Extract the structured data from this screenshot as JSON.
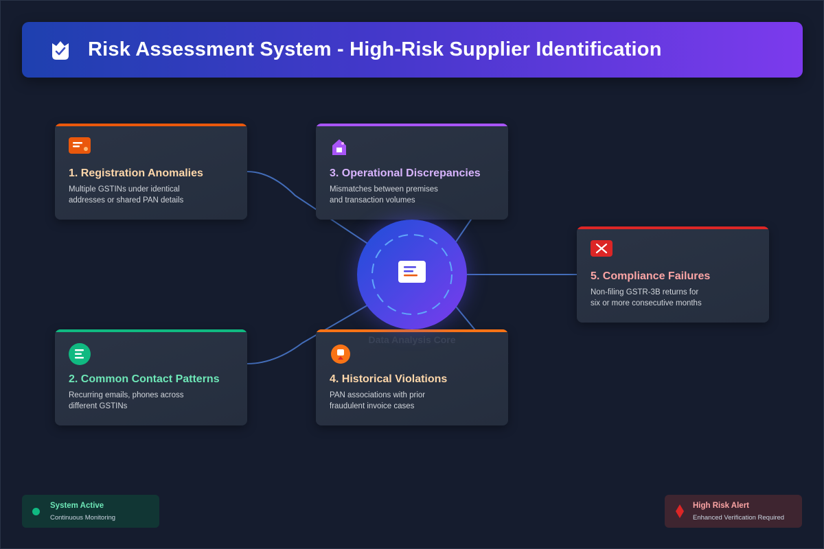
{
  "header": {
    "title": "Risk Assessment System - High-Risk Supplier Identification",
    "icon": "shield-check-icon"
  },
  "core": {
    "label": "Data Analysis Core",
    "icon": "document-icon"
  },
  "cards": [
    {
      "title": "1. Registration Anomalies",
      "desc_line1": "Multiple GSTINs under identical",
      "desc_line2": "addresses or shared PAN details",
      "accent": "#ea580c",
      "title_color": "#fed7aa",
      "icon": "id-card-icon"
    },
    {
      "title": "2. Common Contact Patterns",
      "desc_line1": "Recurring emails, phones across",
      "desc_line2": "different GSTINs",
      "accent": "#10b981",
      "title_color": "#6ee7b7",
      "icon": "list-icon"
    },
    {
      "title": "3. Operational Discrepancies",
      "desc_line1": "Mismatches between premises",
      "desc_line2": "and transaction volumes",
      "accent": "#a855f7",
      "title_color": "#d8b4fe",
      "icon": "building-icon"
    },
    {
      "title": "4. Historical Violations",
      "desc_line1": "PAN associations with prior",
      "desc_line2": "fraudulent invoice cases",
      "accent": "#f97316",
      "title_color": "#fed7aa",
      "icon": "badge-icon"
    },
    {
      "title": "5. Compliance Failures",
      "desc_line1": "Non-filing GSTR-3B returns for",
      "desc_line2": "six or more consecutive months",
      "accent": "#dc2626",
      "title_color": "#fca5a5",
      "icon": "x-mark-icon"
    }
  ],
  "status": {
    "active_title": "System Active",
    "active_sub": "Continuous Monitoring",
    "alert_title": "High Risk Alert",
    "alert_sub": "Enhanced Verification Required",
    "active_color": "#10b981",
    "alert_color": "#dc2626"
  },
  "colors": {
    "background": "#151c2e",
    "connector": "#4b7bd1"
  }
}
